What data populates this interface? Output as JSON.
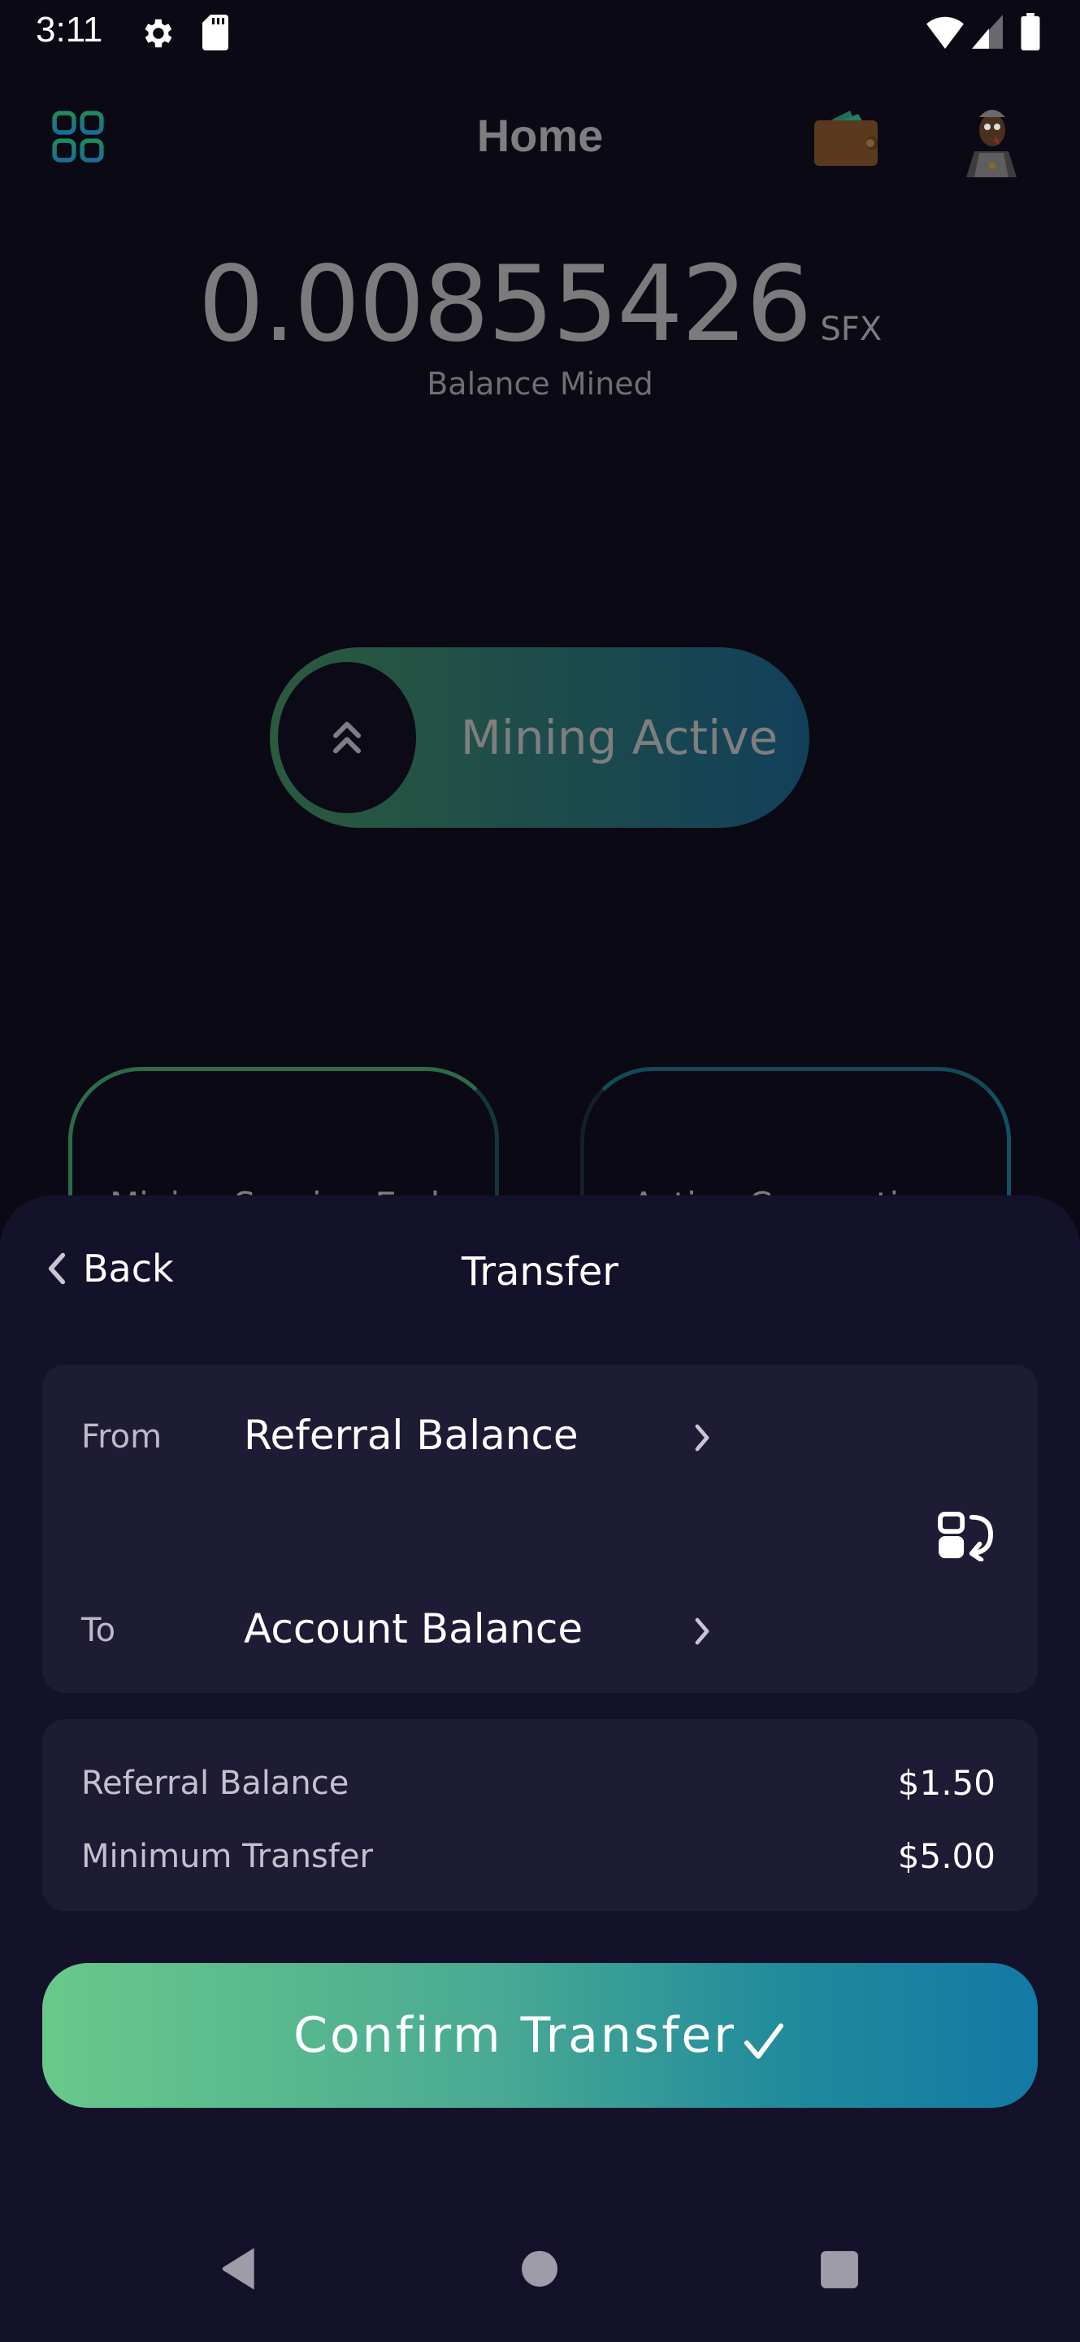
{
  "status_bar": {
    "time": "3:11",
    "icons": [
      "gear-icon",
      "sd-card-icon",
      "wifi-icon",
      "signal-icon",
      "battery-icon"
    ]
  },
  "header": {
    "title": "Home",
    "left_icon": "grid-menu-icon",
    "right_icons": [
      "wallet-icon",
      "avatar"
    ]
  },
  "balance": {
    "amount": "0.00855426",
    "unit": "SFX",
    "label": "Balance Mined"
  },
  "mining": {
    "label": "Mining Active",
    "icon": "double-chevron-up-icon"
  },
  "stat_cards": [
    {
      "label": "Mining Session Ends"
    },
    {
      "label": "Active Connections"
    }
  ],
  "sheet": {
    "back_label": "Back",
    "title": "Transfer",
    "from_label": "From",
    "from_value": "Referral Balance",
    "to_label": "To",
    "to_value": "Account Balance",
    "info": [
      {
        "label": "Referral Balance",
        "value": "$1.50"
      },
      {
        "label": "Minimum Transfer",
        "value": "$5.00"
      }
    ],
    "confirm_label": "Confirm Transfer"
  },
  "colors": {
    "background": "#0a0914",
    "sheet": "#13122a",
    "card": "#1e1b35",
    "gradient_start": "#68c98a",
    "gradient_end": "#127aa4"
  },
  "nav_bar": [
    "back",
    "home",
    "recents"
  ]
}
